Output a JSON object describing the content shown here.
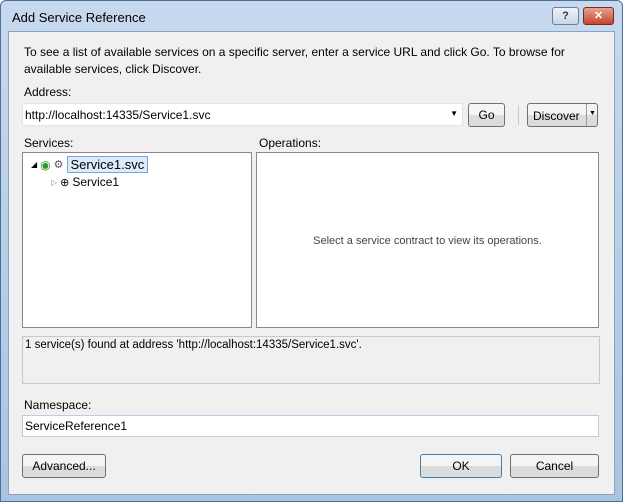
{
  "window": {
    "title": "Add Service Reference",
    "help_label": "?",
    "close_label": "✕"
  },
  "description": "To see a list of available services on a specific server, enter a service URL and click Go. To browse for available services, click Discover.",
  "address": {
    "label": "Address:",
    "value": "http://localhost:14335/Service1.svc",
    "go_label": "Go",
    "discover_label": "Discover"
  },
  "services": {
    "label": "Services:",
    "items": [
      {
        "label": "Service1.svc",
        "expanded": true,
        "selected": true
      },
      {
        "label": "Service1",
        "expanded": false
      }
    ]
  },
  "operations": {
    "label": "Operations:",
    "placeholder": "Select a service contract to view its operations."
  },
  "status": "1 service(s) found at address 'http://localhost:14335/Service1.svc'.",
  "namespace": {
    "label": "Namespace:",
    "value": "ServiceReference1"
  },
  "buttons": {
    "advanced": "Advanced...",
    "ok": "OK",
    "cancel": "Cancel"
  }
}
